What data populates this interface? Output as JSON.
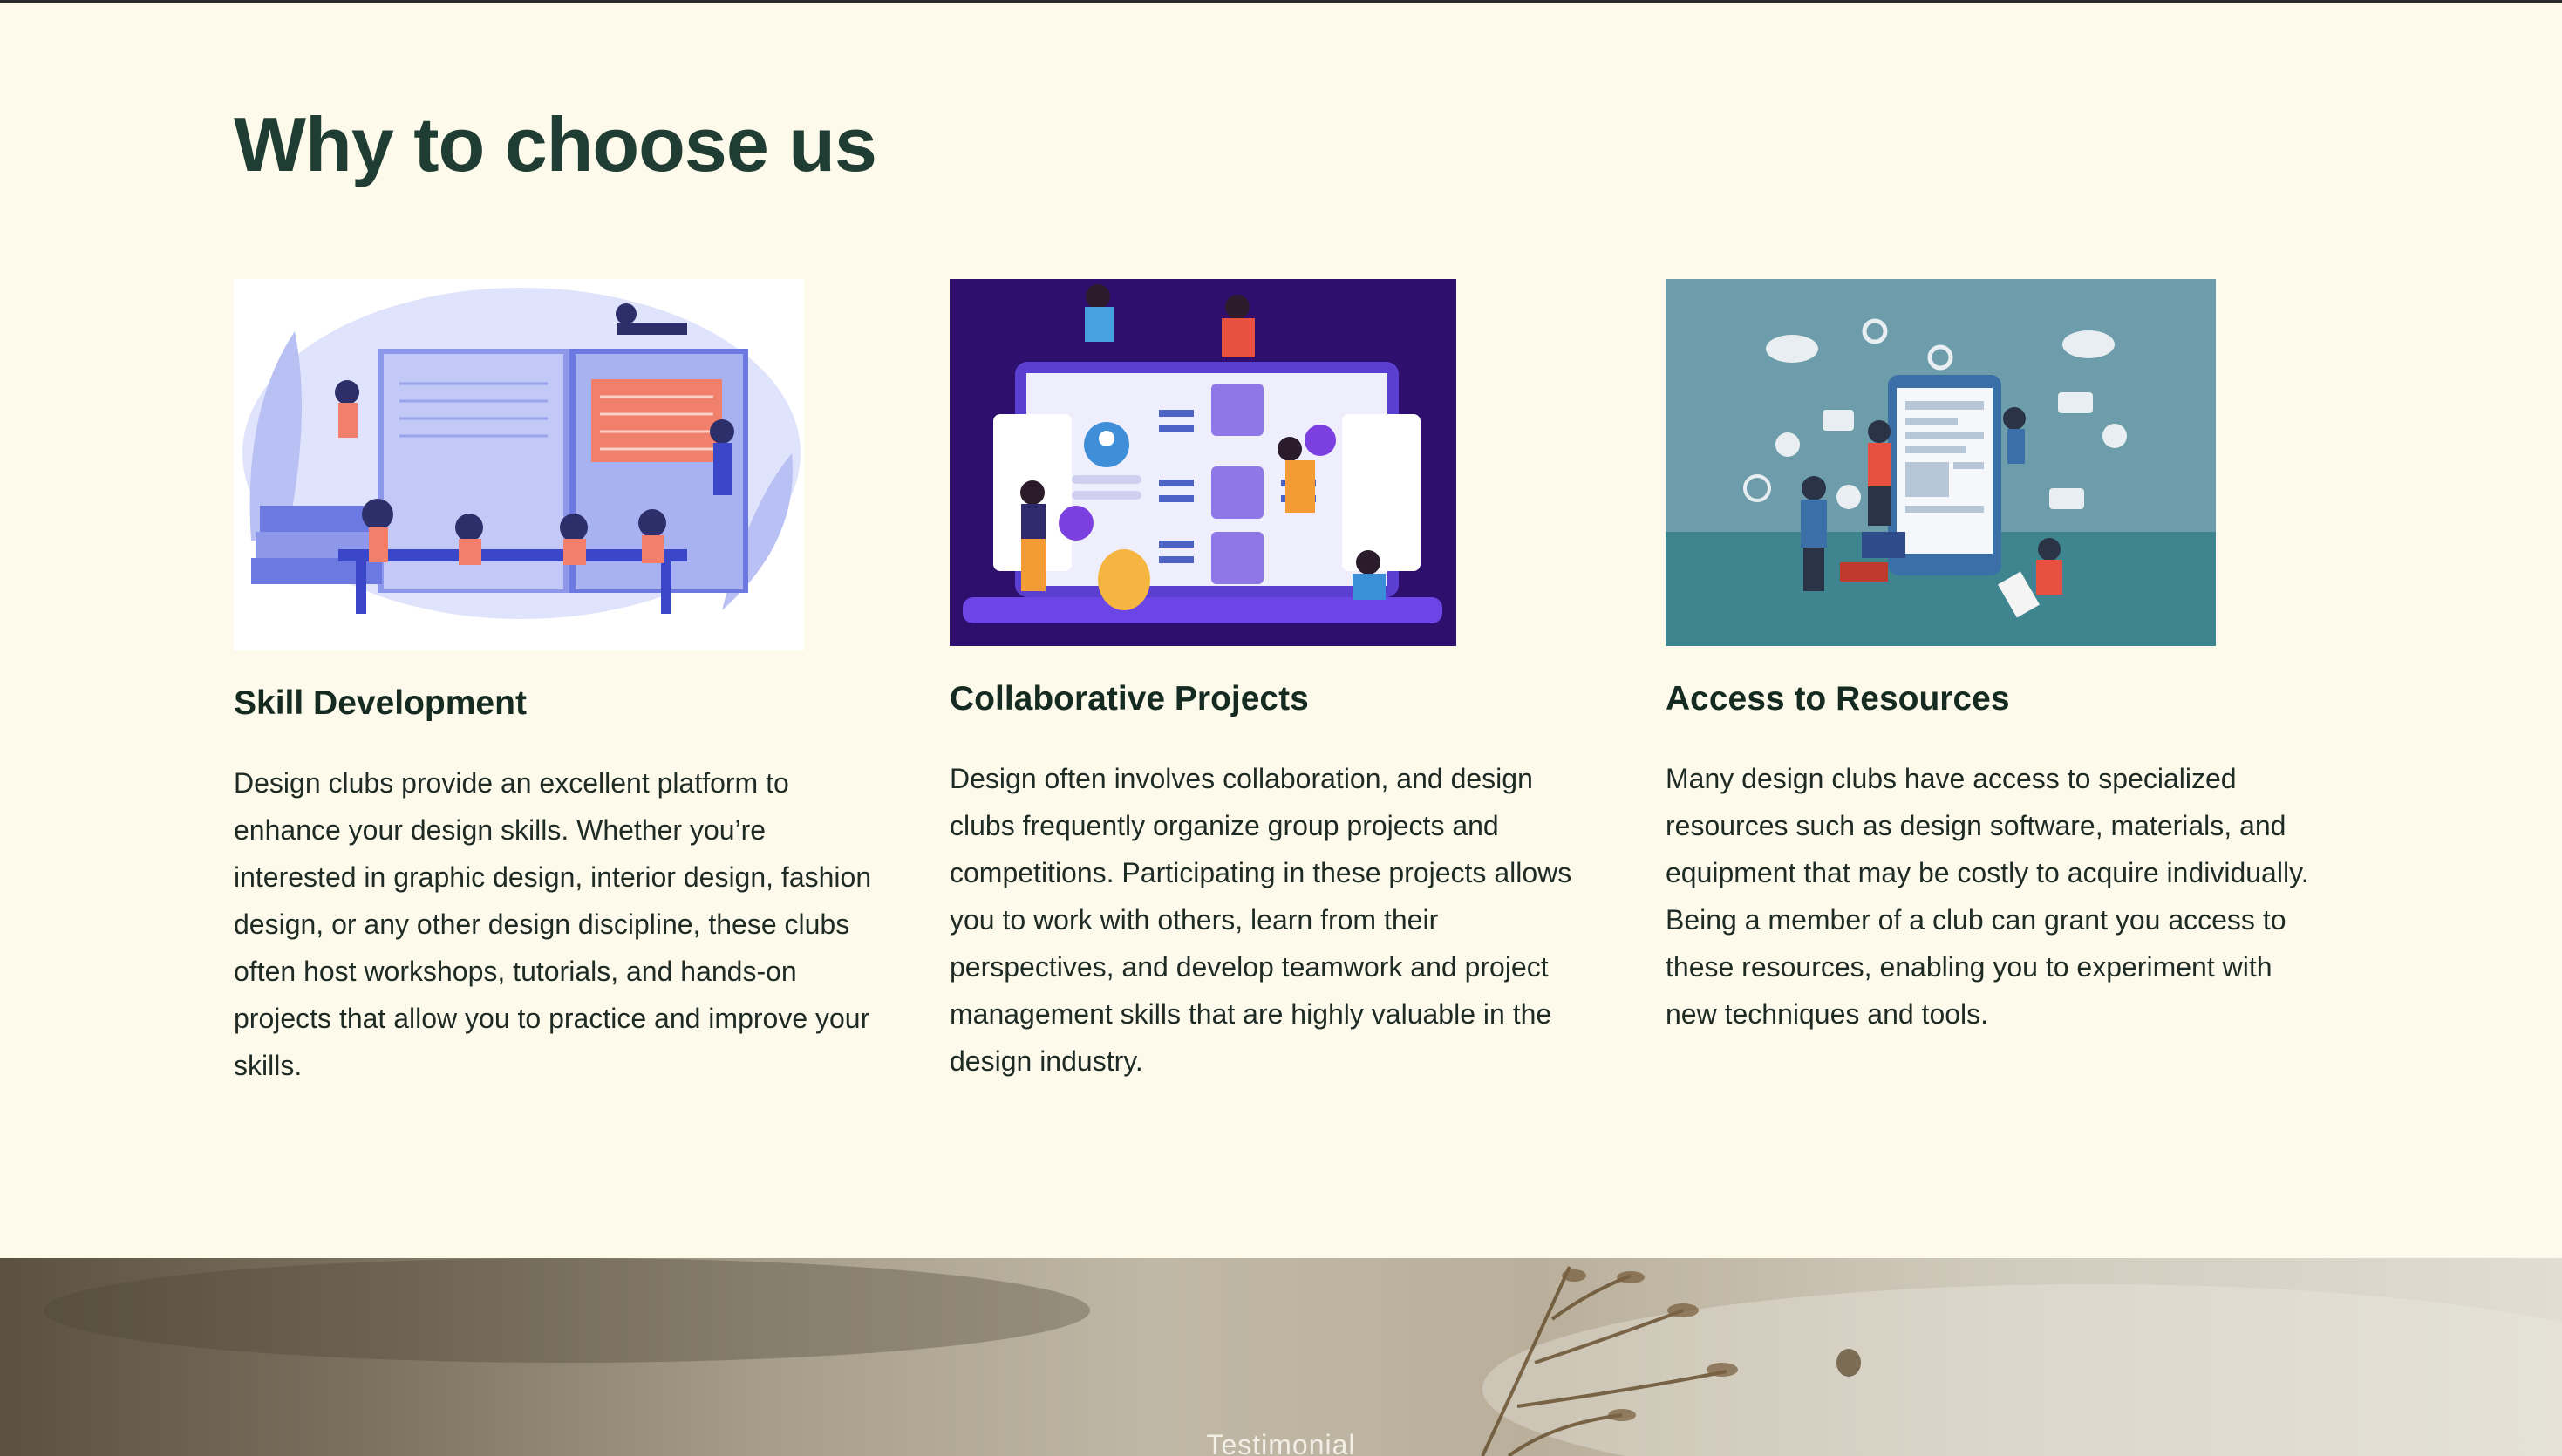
{
  "section": {
    "title": "Why to choose us"
  },
  "cards": [
    {
      "title": "Skill Development",
      "body": "Design clubs provide an excellent platform to enhance your design skills. Whether you’re interested in graphic design, interior design, fashion design, or any other design discipline, these clubs often host workshops, tutorials, and hands-on projects that allow you to practice and improve your skills.",
      "image": "skill-development-illustration"
    },
    {
      "title": "Collaborative Projects",
      "body": "Design often involves collaboration, and design clubs frequently organize group projects and competitions. Participating in these projects allows you to work with others, learn from their perspectives, and develop teamwork and project management skills that are highly valuable in the design industry.",
      "image": "collaborative-projects-illustration"
    },
    {
      "title": "Access to Resources",
      "body": "Many design clubs have access to specialized resources such as design software, materials, and equipment that may be costly to acquire individually. Being a member of a club can grant you access to these resources, enabling you to experiment with new techniques and tools.",
      "image": "access-to-resources-illustration"
    }
  ],
  "testimonial": {
    "label": "Testimonial"
  },
  "colors": {
    "page_background": "#fdfaeb",
    "heading": "#1f3d32",
    "body_text": "#1e2a24"
  }
}
